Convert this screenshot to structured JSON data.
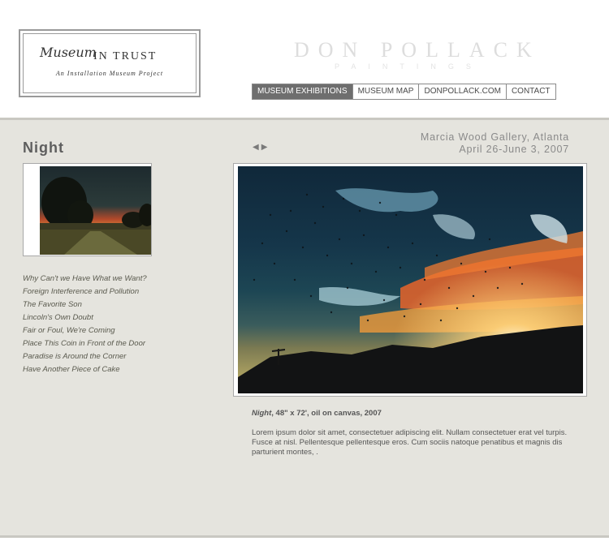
{
  "logo": {
    "script_text": "Museum",
    "words": "IN TRUST",
    "subtitle": "An Installation Museum Project"
  },
  "brand": {
    "title": "DON POLLACK",
    "subtitle": "PAINTINGS"
  },
  "nav": {
    "items": [
      "MUSEUM EXHIBITIONS",
      "MUSEUM MAP",
      "DONPOLLACK.COM",
      "CONTACT"
    ],
    "active": "MUSEUM EXHIBITIONS"
  },
  "page": {
    "title": "Night"
  },
  "venue": {
    "line1": "Marcia Wood Gallery, Atlanta",
    "line2": "April 26-June 3, 2007"
  },
  "arrows": {
    "prev": "◀",
    "next": "▶"
  },
  "paintings": [
    "Why Can't we Have What we Want?",
    "Foreign Interference and Pollution",
    "The Favorite Son",
    "Lincoln's Own Doubt",
    "Fair or Foul, We're Coming",
    "Place This Coin in Front of the Door",
    "Paradise is Around the Corner",
    "Have Another Piece of Cake"
  ],
  "caption": {
    "title": "Night",
    "details": ", 48\" x 72', oil on canvas, 2007"
  },
  "description": "Lorem ipsum dolor sit amet, consectetuer adipiscing elit. Nullam consectetuer erat vel turpis. Fusce at nisl. Pellentesque pellentesque eros. Cum sociis natoque penatibus et magnis dis parturient montes, .",
  "colors": {
    "content_bg": "#e5e4de",
    "nav_active_bg": "#6e6e6e",
    "brand_text": "#dddddd"
  }
}
